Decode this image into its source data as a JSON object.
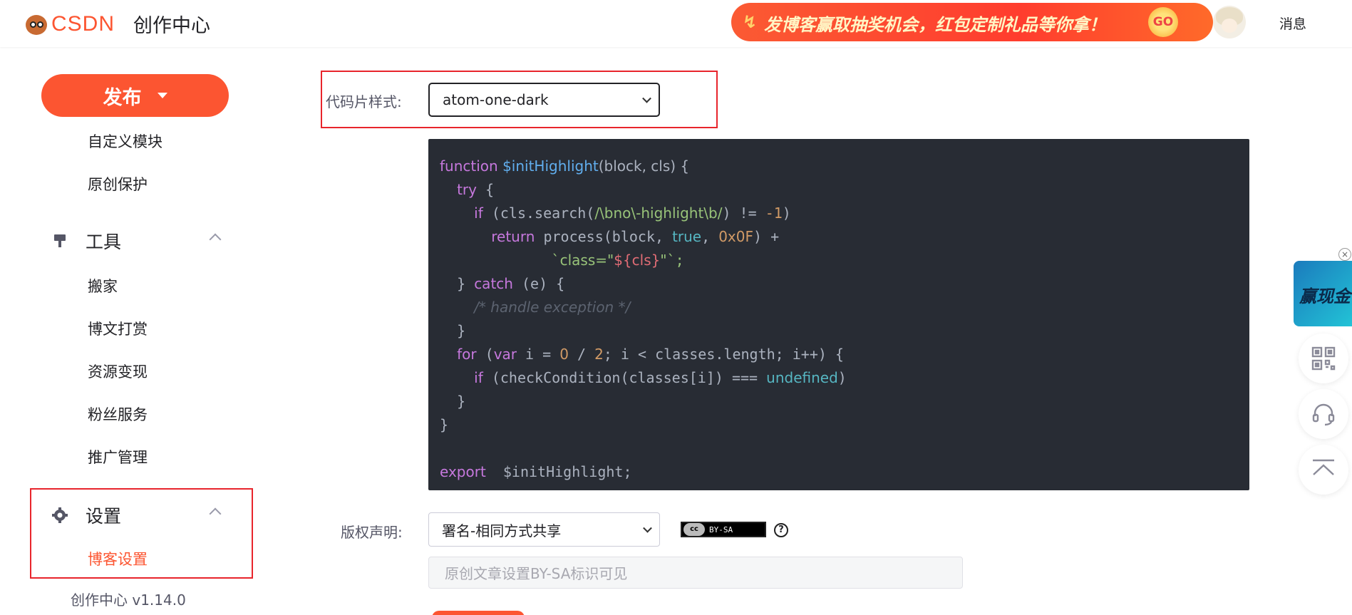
{
  "header": {
    "logo_text": "CSDN",
    "title": "创作中心",
    "banner_text": "发博客赢取抽奖机会，红包定制礼品等你拿！",
    "banner_go": "GO",
    "messages_label": "消息"
  },
  "sidebar": {
    "publish_label": "发布",
    "items_top": [
      "自定义模块",
      "原创保护"
    ],
    "tools_group": "工具",
    "tools_items": [
      "搬家",
      "博文打赏",
      "资源变现",
      "粉丝服务",
      "推广管理"
    ],
    "settings_group": "设置",
    "settings_active_item": "博客设置",
    "version": "创作中心 v1.14.0"
  },
  "main": {
    "code_style_label": "代码片样式:",
    "code_style_value": "atom-one-dark",
    "copyright_label": "版权声明:",
    "copyright_value": "署名-相同方式共享",
    "cc_badge_cc": "cc",
    "cc_badge_label": "BY-SA",
    "help_glyph": "?",
    "note_placeholder": "原创文章设置BY-SA标识可见"
  },
  "code_sample": {
    "l1_kw": "function",
    "l1_fn": "$initHighlight",
    "l1_rest": "(block, cls) {",
    "l2_kw": "try",
    "l2_rest": " {",
    "l3_kw": "if",
    "l3_a": " (cls.search(",
    "l3_re": "/\\bno\\-highlight\\b/",
    "l3_b": ") != ",
    "l3_num": "-1",
    "l3_c": ")",
    "l4_kw": "return",
    "l4_a": " process(block, ",
    "l4_bi": "true",
    "l4_b": ", ",
    "l4_num": "0x0F",
    "l4_c": ") +",
    "l5_q1": "`",
    "l5_str": "class=\"",
    "l5_tv": "${cls}",
    "l5_str2": "\"",
    "l5_q2": "`;",
    "l6_a": "} ",
    "l6_kw": "catch",
    "l6_b": " (e) {",
    "l7_cm": "/* handle exception */",
    "l8": "}",
    "l9_kw": "for",
    "l9_a": " (",
    "l9_kw2": "var",
    "l9_b": " i = ",
    "l9_n1": "0",
    "l9_c": " / ",
    "l9_n2": "2",
    "l9_d": "; i < classes.length; i++) {",
    "l10_kw": "if",
    "l10_a": " (checkCondition(classes[i]) === ",
    "l10_bi": "undefined",
    "l10_b": ")",
    "l11": "}",
    "l12": "}",
    "l14_kw": "export",
    "l14_rest": "  $initHighlight;"
  },
  "float": {
    "ad_text": "赢现金",
    "ad_close": "×"
  },
  "colors": {
    "brand": "#fc5531",
    "highlight_box": "#e8252c",
    "code_bg": "#282c34"
  }
}
